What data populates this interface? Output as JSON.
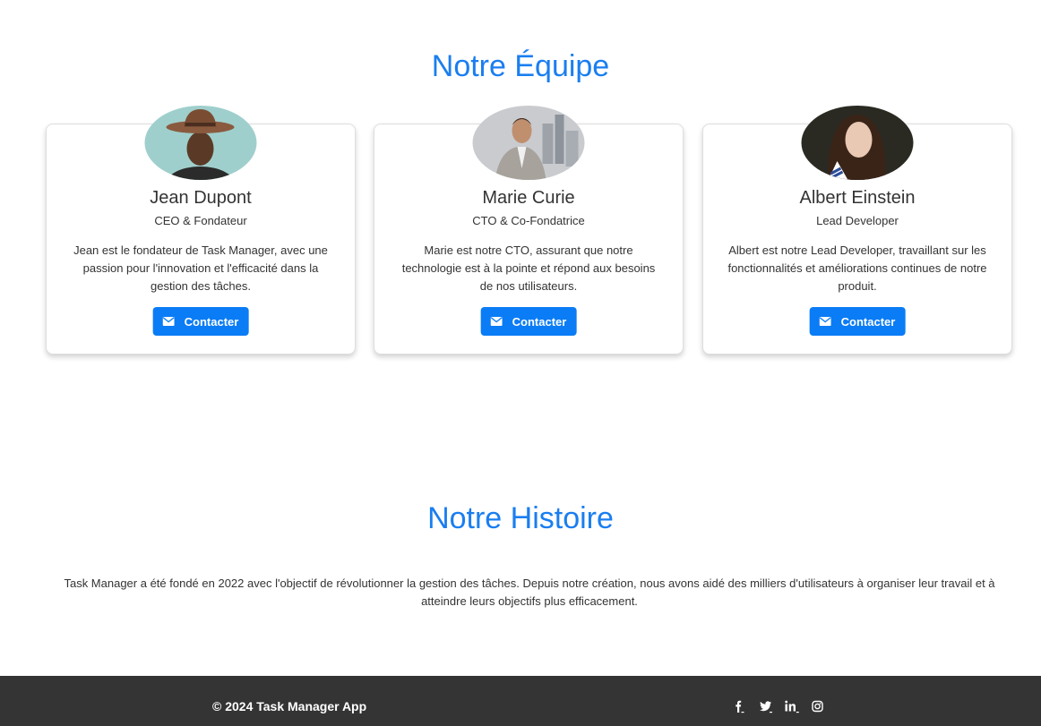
{
  "team": {
    "title": "Notre Équipe",
    "members": [
      {
        "name": "Jean Dupont",
        "role": "CEO & Fondateur",
        "bio": "Jean est le fondateur de Task Manager, avec une passion pour l'innovation et l'efficacité dans la gestion des tâches.",
        "button_label": "Contacter",
        "photo_icon": "portrait-woman-hat"
      },
      {
        "name": "Marie Curie",
        "role": "CTO & Co-Fondatrice",
        "bio": "Marie est notre CTO, assurant que notre technologie est à la pointe et répond aux besoins de nos utilisateurs.",
        "button_label": "Contacter",
        "photo_icon": "portrait-man-suit-city"
      },
      {
        "name": "Albert Einstein",
        "role": "Lead Developer",
        "bio": "Albert est notre Lead Developer, travaillant sur les fonctionnalités et améliorations continues de notre produit.",
        "button_label": "Contacter",
        "photo_icon": "portrait-woman-dark-hair"
      }
    ]
  },
  "history": {
    "title": "Notre Histoire",
    "text": "Task Manager a été fondé en 2022 avec l'objectif de révolutionner la gestion des tâches. Depuis notre création, nous avons aidé des milliers d'utilisateurs à organiser leur travail et à atteindre leurs objectifs plus efficacement."
  },
  "footer": {
    "copyright": "© 2024 Task Manager App",
    "socials": [
      "facebook-icon",
      "twitter-icon",
      "linkedin-icon",
      "instagram-icon"
    ]
  },
  "colors": {
    "accent": "#1a7ef0",
    "button": "#0a7cf5",
    "footer_bg": "#343434"
  }
}
